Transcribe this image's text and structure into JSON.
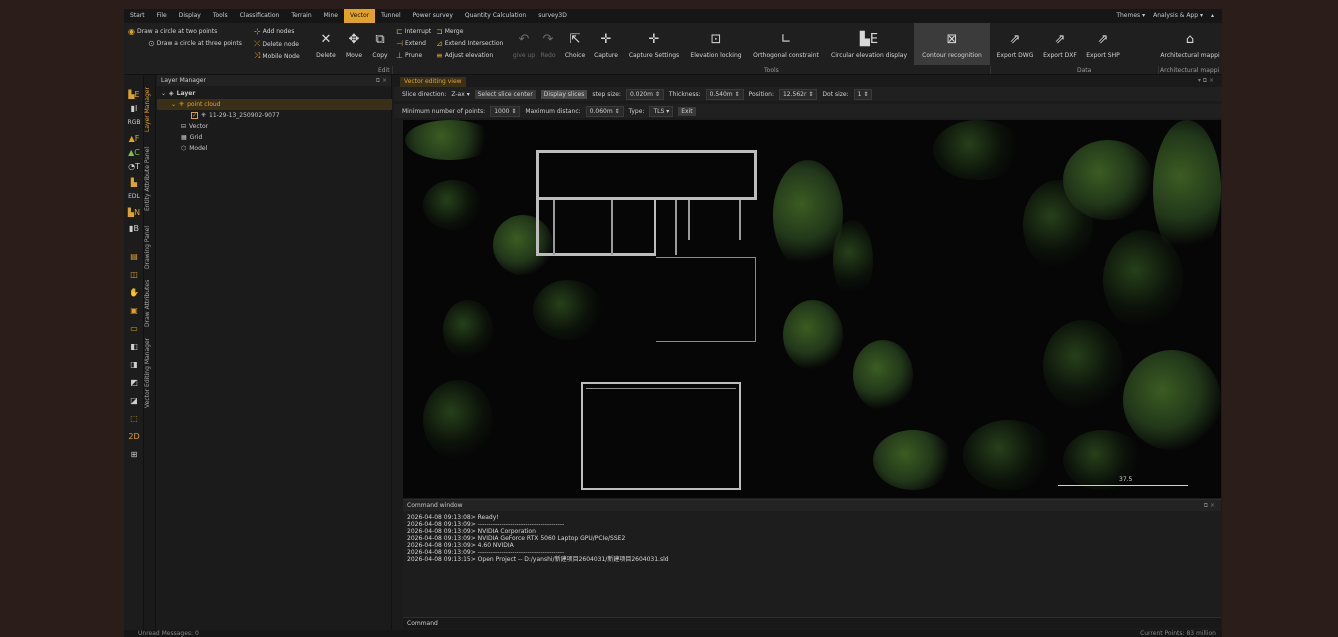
{
  "menubar": {
    "items": [
      "Start",
      "File",
      "Display",
      "Tools",
      "Classification",
      "Terrain",
      "Mine",
      "Vector",
      "Tunnel",
      "Power survey",
      "Quantity Calculation",
      "survey3D"
    ],
    "active": "Vector",
    "themes": "Themes",
    "analysis": "Analysis & App"
  },
  "ribbon": {
    "small": {
      "circle_two": "Draw a circle at two points",
      "circle_three": "Draw a circle at three points",
      "add_nodes": "Add nodes",
      "delete_node": "Delete node",
      "mobile_node": "Mobile Node",
      "interrupt": "Interrupt",
      "extend": "Extend",
      "prune": "Prune",
      "merge": "Merge",
      "extend_intersection": "Extend Intersection",
      "adjust_elevation": "Adjust elevation"
    },
    "big": {
      "delete": "Delete",
      "move": "Move",
      "copy": "Copy",
      "give_up": "give up",
      "redo": "Redo",
      "choice": "Choice",
      "capture": "Capture",
      "capture_settings": "Capture Settings",
      "elevation_locking": "Elevation locking",
      "orthogonal": "Orthogonal constraint",
      "circular_elevation": "Circular elevation display",
      "contour": "Contour recognition",
      "export_dwg": "Export DWG",
      "export_dxf": "Export DXF",
      "export_shp": "Export SHP",
      "architectural": "Architectural mappi"
    },
    "groups": {
      "edit": "Edit",
      "tools": "Tools",
      "data": "Data",
      "architectural": "Architectural mappi"
    }
  },
  "leftstrip": {
    "rgb": "RGB",
    "edl": "EDL",
    "twod": "2D"
  },
  "vtabs": {
    "layer_manager": "Layer Manager",
    "entity_attribute": "Entity Attribute Panel",
    "drawing_panel": "Drawing Panel",
    "draw_attributes": "Draw Attributes",
    "vector_editing": "Vector Editing Manager"
  },
  "layer_manager": {
    "title": "Layer Manager",
    "root": "Layer",
    "point_cloud": "point cloud",
    "cloud_item": "11-29-13_250902-9077",
    "vector": "Vector",
    "grid": "Grid",
    "model": "Model"
  },
  "view": {
    "tab": "Vector editing view",
    "slice_direction_label": "Slice direction:",
    "slice_direction_value": "Z-ax",
    "select_slice_center": "Select slice center",
    "display_slices": "Display slices",
    "step_size_label": "step size:",
    "step_size_value": "0.020m",
    "thickness_label": "Thickness:",
    "thickness_value": "0.540m",
    "position_label": "Position:",
    "position_value": "12.562r",
    "dot_size_label": "Dot size:",
    "dot_size_value": "1",
    "min_points_label": "Minimum number of points:",
    "min_points_value": "1000",
    "max_distance_label": "Maximum distanc:",
    "max_distance_value": "0.060m",
    "type_label": "Type:",
    "type_value": "TLS",
    "exit": "Exit",
    "scale_label": "37.5"
  },
  "command_window": {
    "title": "Command window",
    "lines": [
      "2026-04-08 09:13:08> Ready!",
      "2026-04-08 09:13:09> ----------------------------------------",
      "2026-04-08 09:13:09> NVIDIA Corporation",
      "2026-04-08 09:13:09> NVIDIA GeForce RTX 5060 Laptop GPU/PCIe/SSE2",
      "2026-04-08 09:13:09> 4.60 NVIDIA",
      "2026-04-08 09:13:09> ----------------------------------------",
      "2026-04-08 09:13:15> Open Project -- D:/yanshi/新建项目2604031/新建项目2604031.sld"
    ],
    "input_label": "Command"
  },
  "status": {
    "left": "Unread Messages: 0",
    "right": "Current Points: 83 million"
  },
  "colors": {
    "accent": "#e0a22a",
    "background": "#1b1b1b",
    "viewport": "#060606"
  }
}
